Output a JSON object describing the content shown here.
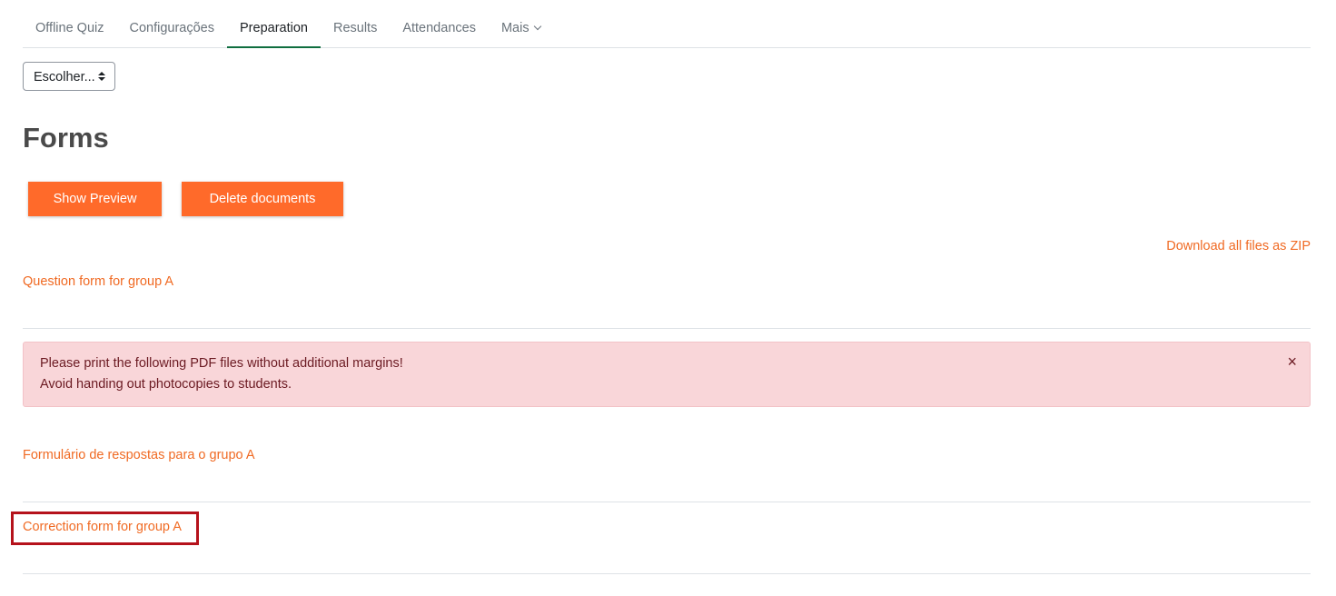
{
  "nav": {
    "tabs": [
      {
        "label": "Offline Quiz"
      },
      {
        "label": "Configurações"
      },
      {
        "label": "Preparation"
      },
      {
        "label": "Results"
      },
      {
        "label": "Attendances"
      },
      {
        "label": "Mais"
      }
    ],
    "active_tab": "Preparation"
  },
  "chooser": {
    "value": "Escolher..."
  },
  "page": {
    "title": "Forms"
  },
  "buttons": {
    "preview": "Show Preview",
    "delete": "Delete documents"
  },
  "links": {
    "download_zip": "Download all files as ZIP",
    "question_form": "Question form for group A",
    "answer_form": "Formulário de respostas para o grupo A",
    "correction_form": "Correction form for group A"
  },
  "alert": {
    "line1": "Please print the following PDF files without additional margins!",
    "line2": "Avoid handing out photocopies to students.",
    "close": "×"
  },
  "colors": {
    "accent": "#ff6a2a",
    "link": "#f06a23",
    "alert_bg": "#f9d6d9",
    "highlight": "#b5121b"
  }
}
